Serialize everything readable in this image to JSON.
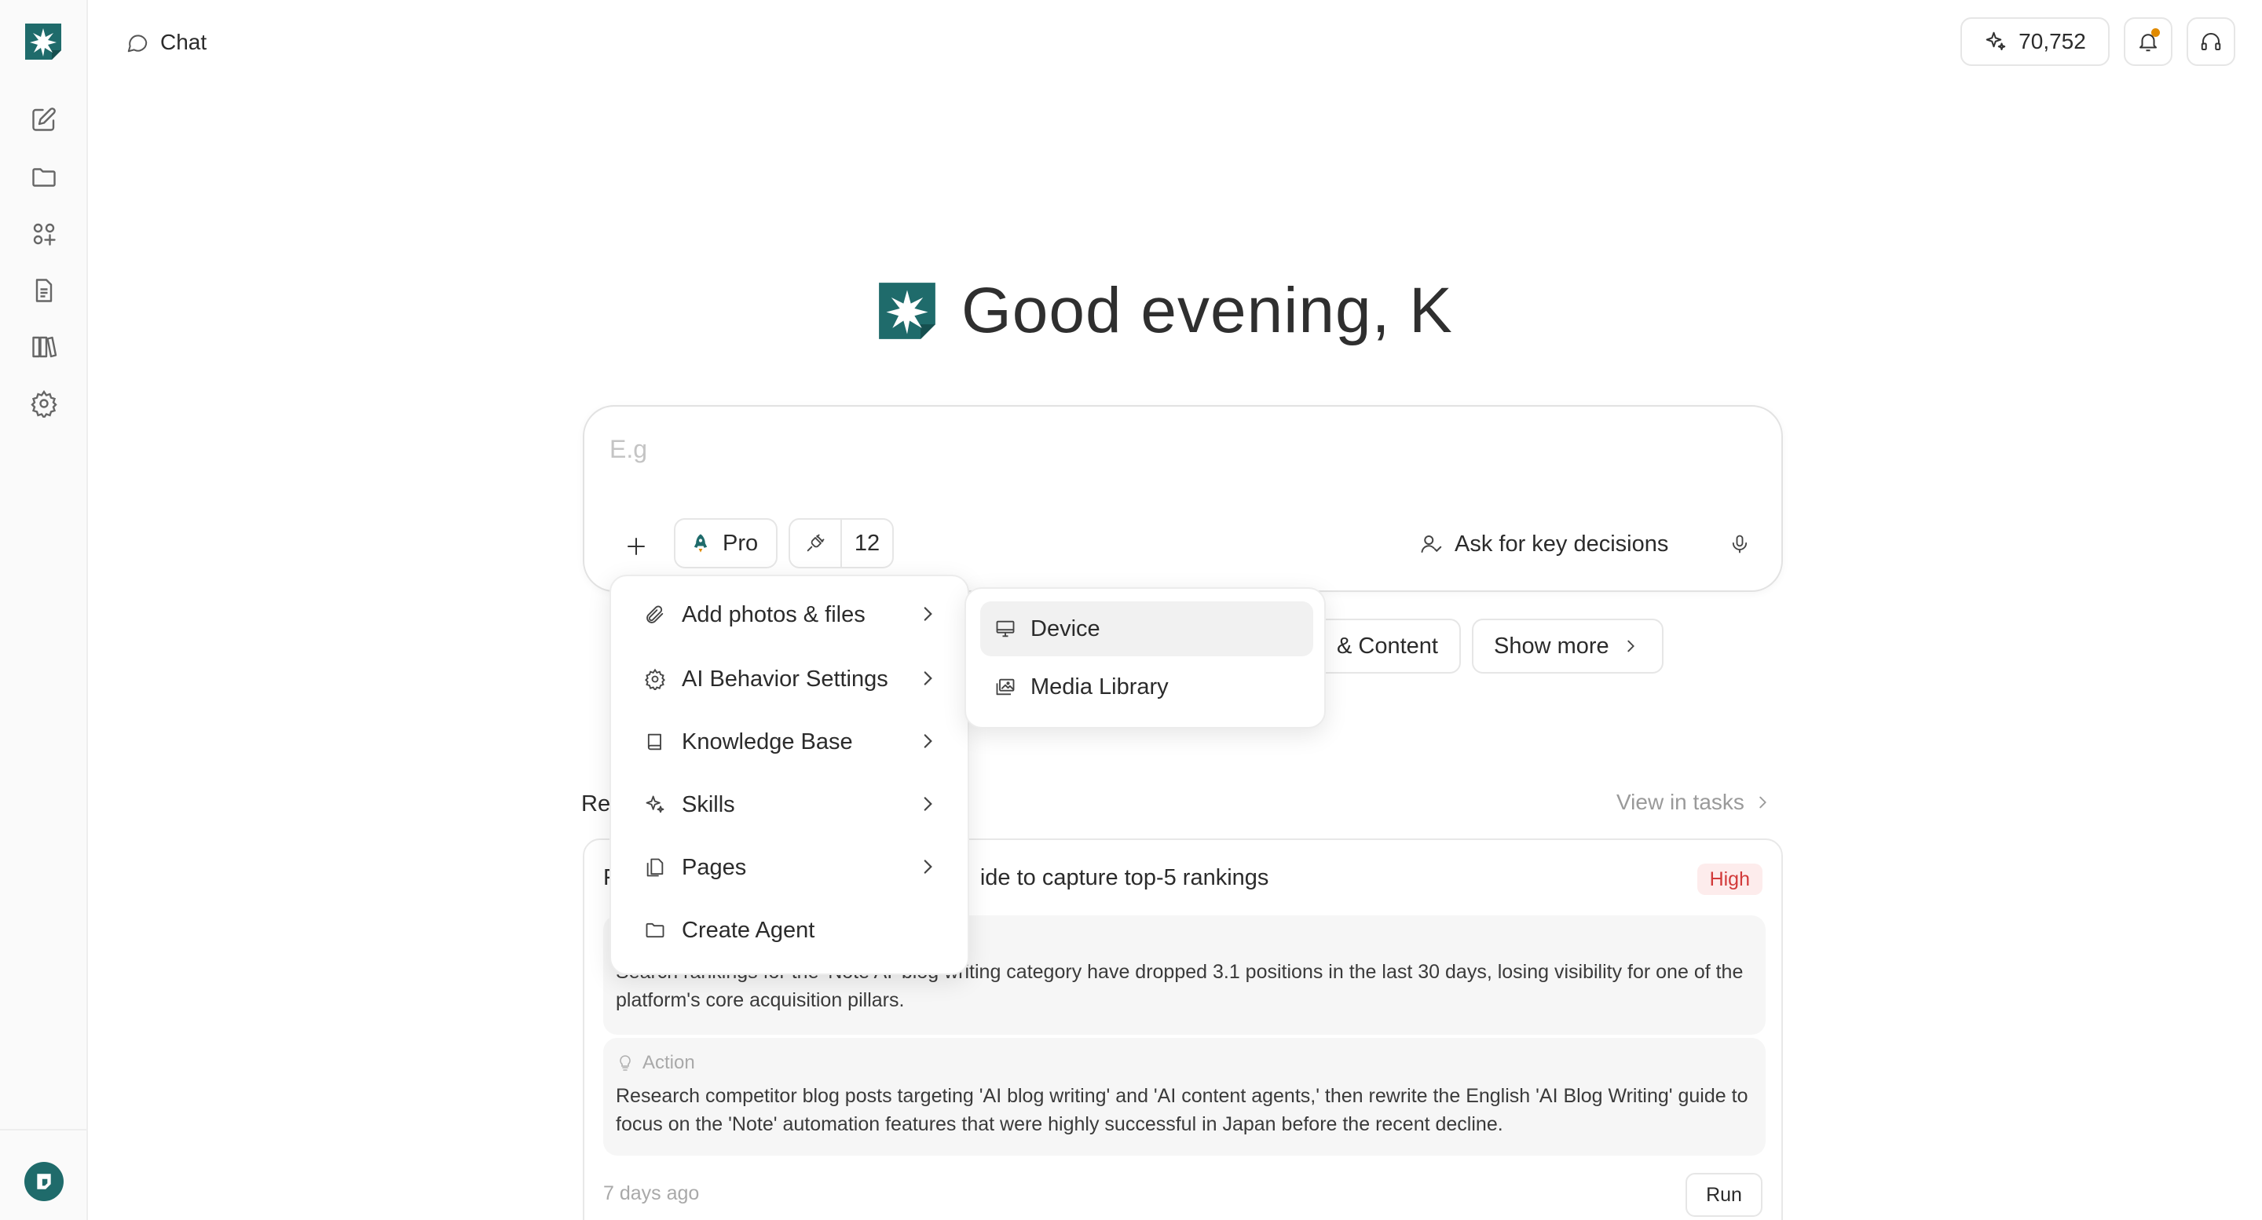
{
  "header": {
    "breadcrumb": "Chat",
    "credits": "70,752"
  },
  "greeting": {
    "text": "Good evening, K"
  },
  "composer": {
    "placeholder": "E.g",
    "mode_label": "Pro",
    "tools_count": "12",
    "ask_label": "Ask for key decisions"
  },
  "suggestions": {
    "partial_label": "& Content",
    "show_more_label": "Show more"
  },
  "recent": {
    "label_partial": "Re",
    "view_tasks": "View in tasks",
    "task": {
      "title_prefix": "F",
      "title_partial": "ide to capture top-5 rankings",
      "priority": "High",
      "problem_text": "Search rankings for the 'Note AI' blog writing category have dropped 3.1 positions in the last 30 days, losing visibility for one of the platform's core acquisition pillars.",
      "action_heading": "Action",
      "action_text": "Research competitor blog posts targeting 'AI blog writing' and 'AI content agents,' then rewrite the English 'AI Blog Writing' guide to focus on the 'Note' automation features that were highly successful in Japan before the recent decline.",
      "time": "7 days ago",
      "run_label": "Run"
    }
  },
  "menu": {
    "items": [
      {
        "label": "Add photos & files",
        "icon": "paperclip-icon"
      },
      {
        "label": "AI Behavior Settings",
        "icon": "gear-icon"
      },
      {
        "label": "Knowledge Base",
        "icon": "book-icon"
      },
      {
        "label": "Skills",
        "icon": "sparkle-icon"
      },
      {
        "label": "Pages",
        "icon": "pages-icon"
      },
      {
        "label": "Create Agent",
        "icon": "folder-icon"
      }
    ]
  },
  "submenu": {
    "items": [
      {
        "label": "Device",
        "icon": "monitor-icon"
      },
      {
        "label": "Media Library",
        "icon": "images-icon"
      }
    ]
  },
  "colors": {
    "brand": "#1f6b6b",
    "priority_high": "#d23a3a",
    "notification_dot": "#e08a00"
  }
}
